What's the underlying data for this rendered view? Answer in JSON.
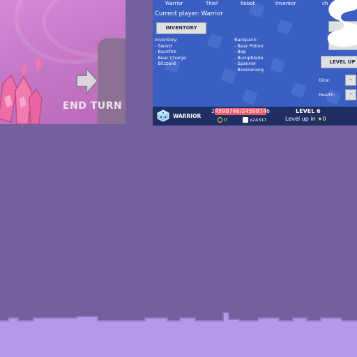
{
  "scene": {
    "end_turn_label": "END TURN"
  },
  "debug": {
    "tabs": [
      "Warrior",
      "Thief",
      "Robot",
      "Inventor",
      "ch"
    ],
    "current_player": "Current player: Warrior",
    "inventory_button": "INVENTORY",
    "inventory_heading": "Inventory:",
    "inventory_items": [
      "- Sword",
      "- Backfire",
      "- Bear Charge",
      "- Blizzard"
    ],
    "backpack_heading": "Backpack:",
    "backpack_items": [
      "- Bear Potion",
      "- Bop",
      "- Bumpblade",
      "- Spanner",
      "- Boomerang"
    ],
    "level_up_button": "LEVEL UP",
    "dice_label": "Dice:",
    "health_label": "Health:",
    "minus_label": "-"
  },
  "status": {
    "class_name": "WARRIOR",
    "hp_text": "24598746/24598746",
    "hp_fraction": 1.0,
    "gold": "0",
    "dice": "x24317",
    "level": "LEVEL 6",
    "level_up_text": "Level up in",
    "level_up_amount": "0"
  },
  "colors": {
    "background": "#73609c",
    "panel_blue": "#3a5ec2",
    "statusbar": "#1f2e63",
    "hp_red": "#e65c6e",
    "gold": "#f3d033",
    "ground": "#b399e8"
  },
  "icons": {
    "class": "dice-class-icon",
    "gold": "gold-coin-icon",
    "dice": "dice-icon",
    "star": "star-icon",
    "end_turn": "arrow-right-icon"
  }
}
